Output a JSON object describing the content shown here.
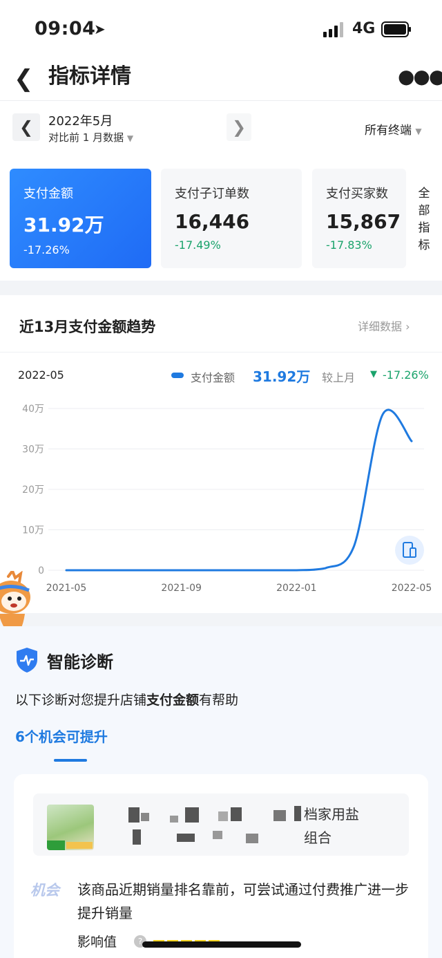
{
  "status_bar": {
    "time": "09:04",
    "network": "4G",
    "location_icon": "navigation-arrow-icon"
  },
  "nav": {
    "back_icon": "chevron-left-icon",
    "title": "指标详情",
    "more_icon": "more-dots-icon"
  },
  "date_bar": {
    "title": "2022年5月",
    "compare": "对比前 1 月数据",
    "terminal": "所有终端"
  },
  "metrics": [
    {
      "label": "支付金额",
      "value": "31.92万",
      "change": "-17.26%"
    },
    {
      "label": "支付子订单数",
      "value": "16,446",
      "change": "-17.49%"
    },
    {
      "label": "支付买家数",
      "value": "15,867",
      "change": "-17.83%"
    }
  ],
  "all_metrics": "全部指标",
  "trend": {
    "title": "近13月支付金额趋势",
    "detail_link": "详细数据",
    "selected_date": "2022-05",
    "legend_name": "支付金额",
    "legend_value": "31.92万",
    "compare_label": "较上月",
    "compare_change": "-17.26%"
  },
  "chart_data": {
    "type": "line",
    "title": "",
    "xlabel": "",
    "ylabel": "",
    "ylim": [
      0,
      400000
    ],
    "yticks": [
      "0",
      "10万",
      "20万",
      "30万",
      "40万"
    ],
    "xticks": [
      "2021-05",
      "2021-09",
      "2022-01",
      "2022-05"
    ],
    "x": [
      "2021-05",
      "2021-06",
      "2021-07",
      "2021-08",
      "2021-09",
      "2021-10",
      "2021-11",
      "2021-12",
      "2022-01",
      "2022-02",
      "2022-03",
      "2022-04",
      "2022-05"
    ],
    "series": [
      {
        "name": "支付金额",
        "color": "#1f7ae0",
        "values": [
          0,
          0,
          0,
          0,
          0,
          0,
          0,
          0,
          0,
          5000,
          60000,
          386000,
          319200
        ]
      }
    ],
    "grid": true
  },
  "diagnosis": {
    "title": "智能诊断",
    "desc_prefix": "以下诊断对您提升店铺",
    "desc_bold": "支付金额",
    "desc_suffix": "有帮助",
    "tab": "6个机会可提升",
    "product_name_line1": "档家用盐",
    "product_name_line2": "组合",
    "opportunity_badge": "机会",
    "opportunity_text": "该商品近期销量排名靠前，可尝试通过付费推广进一步提升销量",
    "impact_label": "影响值"
  }
}
